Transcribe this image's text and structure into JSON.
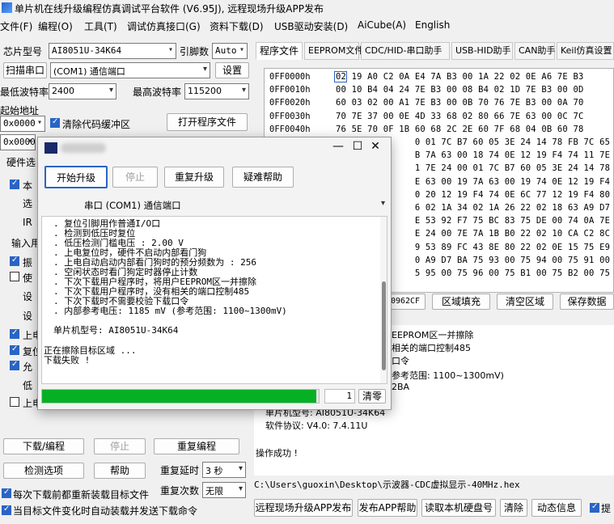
{
  "title": "单片机在线升级编程仿真调试平台软件 (V6.95J), 远程现场升级APP发布",
  "menu": [
    "文件(F)",
    "编程(O)",
    "工具(T)",
    "调试仿真接口(G)",
    "资料下载(D)",
    "USB驱动安装(D)",
    "AiCube(A)",
    "English"
  ],
  "left": {
    "chip_label": "芯片型号",
    "chip_value": "AI8051U-34K64",
    "pin_label": "引脚数",
    "pin_value": "Auto",
    "scan_button": "扫描串口",
    "port_value": "(COM1) 通信端口",
    "settings_button": "设置",
    "min_baud_label": "最低波特率",
    "min_baud_value": "2400",
    "max_baud_label": "最高波特率",
    "max_baud_value": "115200",
    "start_addr_label": "起始地址",
    "start_addr_value": "0x0000",
    "clear_buffer_label": "清除代码缓冲区",
    "open_program_button": "打开程序文件",
    "addr2_value": "0x0000",
    "hw_options_label": "硬件选",
    "partial_labels": [
      "本",
      "选",
      "IR",
      "输入用",
      "振",
      "使",
      "设",
      "设",
      "上电",
      "复位",
      "允",
      "低",
      "上电"
    ],
    "download_button": "下载/编程",
    "stop_button": "停止",
    "repeat_program_button": "重复编程",
    "check_options_button": "检测选项",
    "help_button": "帮助",
    "repeat_delay_label": "重复延时",
    "repeat_delay_value": "3 秒",
    "repeat_count_label": "重复次数",
    "repeat_count_value": "无限",
    "reload_each_label": "每次下载前都重新装载目标文件",
    "auto_reload_label": "当目标文件变化时自动装载并发送下载命令"
  },
  "tabs": [
    "程序文件",
    "EEPROM文件",
    "CDC/HID-串口助手",
    "USB-HID助手",
    "CAN助手",
    "Keil仿真设置"
  ],
  "hex": {
    "rows": [
      {
        "addr": "0FF0000h",
        "bytes": "02 19 A0 C2 0A E4 7A B3 00 1A 22 02 0E A6 7E B3"
      },
      {
        "addr": "0FF0010h",
        "bytes": "00 10 B4 04 24 7E B3 00 08 B4 02 1D 7E B3 00 0D"
      },
      {
        "addr": "0FF0020h",
        "bytes": "60 03 02 00 A1 7E B3 00 0B 70 76 7E B3 00 0A 70"
      },
      {
        "addr": "0FF0030h",
        "bytes": "70 7E 37 00 0E 4D 33 68 02 80 66 7E 63 00 0C 7C"
      },
      {
        "addr": "0FF0040h",
        "bytes": "76 5E 70 0F 1B 60 68 2C 2E 60 7F 68 04 0B 60 78"
      },
      {
        "addr": "",
        "bytes": "               0 01 7C B7 60 05 3E 24 14 78 FB 7C 65"
      },
      {
        "addr": "",
        "bytes": "               B 7A 63 00 18 74 0E 12 19 F4 74 11 7E"
      },
      {
        "addr": "",
        "bytes": "               1 7E 24 00 01 7C B7 60 05 3E 24 14 78"
      },
      {
        "addr": "",
        "bytes": "               E 63 00 19 7A 63 00 19 74 0E 12 19 F4"
      },
      {
        "addr": "",
        "bytes": "               0 20 12 19 F4 74 0E 6C 77 12 19 F4 80"
      },
      {
        "addr": "",
        "bytes": "               6 02 1A 34 02 1A 26 22 02 18 63 A9 D7"
      },
      {
        "addr": "",
        "bytes": "               E 53 92 F7 75 BC 83 75 DE 00 74 0A 7E"
      },
      {
        "addr": "",
        "bytes": "               E 24 00 7E 7A 1B B0 22 02 10 CA C2 8C"
      },
      {
        "addr": "",
        "bytes": "               9 53 89 FC 43 8E 80 22 02 0E 15 75 E9"
      },
      {
        "addr": "",
        "bytes": "               0 A9 D7 BA 75 93 00 75 94 00 75 91 00"
      },
      {
        "addr": "",
        "bytes": "               5 95 00 75 96 00 75 B1 00 75 B2 00 75"
      }
    ]
  },
  "right_buttons": {
    "checksum": "0962CF",
    "fill": "区域填充",
    "clear": "清空区域",
    "save": "保存数据"
  },
  "log_right": [
    "EEPROM区一并擦除",
    "相关的端口控制485",
    "口令",
    "参考范围: 1100~1300mV)",
    "2BA",
    "单片机型号: AI8051U-34K64",
    "软件协议: V4.0: 7.4.11U",
    "操作成功 !"
  ],
  "path": "C:\\Users\\guoxin\\Desktop\\示波器-CDC虚拟显示-40MHz.hex",
  "bottom_buttons": [
    "远程现场升级APP发布",
    "发布APP帮助",
    "读取本机硬盘号",
    "清除",
    "动态信息",
    "提"
  ],
  "dialog": {
    "start_button": "开始升级",
    "stop_button": "停止",
    "repeat_button": "重复升级",
    "faq_button": "疑难帮助",
    "port_value": "串口 (COM1) 通信端口",
    "log": [
      ". 复位引脚用作普通I/O口",
      ". 检测到低压时复位",
      ". 低压检测门槛电压 : 2.00 V",
      ". 上电复位时，硬件不启动内部看门狗",
      ". 上电自动启动内部看门狗时的预分频数为 : 256",
      ". 空闲状态时看门狗定时器停止计数",
      ". 下次下载用户程序时，将用户EEPROM区一并擦除",
      ". 下次下载用户程序时，没有相关的端口控制485",
      ". 下次下载时不需要校验下载口令",
      ". 内部参考电压: 1185 mV (参考范围: 1100~1300mV)",
      "",
      "单片机型号: AI8051U-34K64",
      "",
      "正在擦除目标区域 ...",
      "下载失败 !"
    ],
    "progress": 0.99,
    "counter": "1",
    "clear_button": "清零"
  },
  "colors": {
    "progress": "#06b025",
    "accent": "#2a64c5"
  }
}
